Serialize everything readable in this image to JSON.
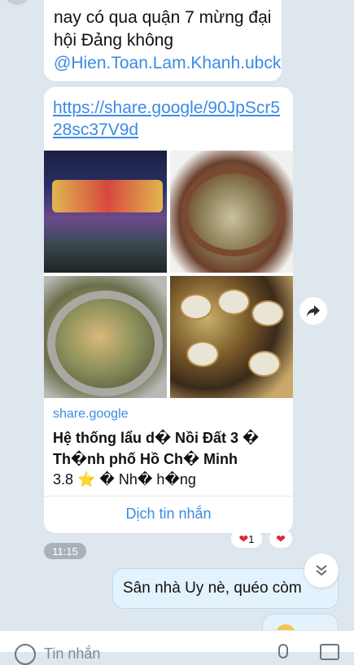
{
  "messages": {
    "received_text": {
      "text": "nay có qua quận 7 mừng đại hội Đảng không ",
      "mention": "@Hien.Toan.Lam.Khanh.ubck"
    },
    "link_card": {
      "url": "https://share.google/90JpScr528sc37V9d",
      "source": "share.google",
      "place_title": "Hệ thống lẩu d� Nồi Đất 3 � Th�nh phố Hồ Ch� Minh",
      "rating_text": "3.8 ⭐ � Nh� h�ng",
      "translate_label": "Dịch tin nhắn"
    },
    "reactions": [
      {
        "icon": "heart-icon",
        "count": "1"
      },
      {
        "icon": "heart-icon",
        "count": ""
      }
    ],
    "time": "11:15",
    "sent_text": "Sân nhà Uy nè, quéo còm"
  },
  "input": {
    "placeholder": "Tin nhắn"
  },
  "colors": {
    "background": "#dfe7ee",
    "link": "#3c8ae6",
    "sent_bubble": "#e4f2fd",
    "heart": "#e0283a"
  }
}
